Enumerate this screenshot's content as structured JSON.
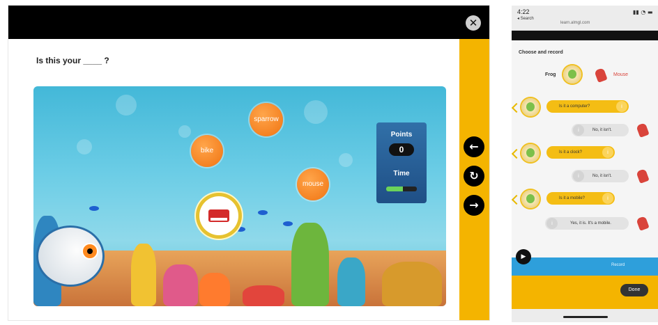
{
  "game": {
    "close_glyph": "✕",
    "question_prefix": "Is this your ____ ?",
    "question_hint": "",
    "words": [
      "sparrow",
      "bike",
      "mouse"
    ],
    "scoreboard": {
      "points_label": "Points",
      "points_value": "0",
      "time_label": "Time",
      "time_fraction": 0.55
    },
    "nav": {
      "prev_glyph": "←",
      "replay_glyph": "↻",
      "next_glyph": "→"
    }
  },
  "phone": {
    "status_time": "4:22",
    "status_back": "◂ Search",
    "url": "learn.almgl.com",
    "status_icons": "▮▮ ◔ ▬",
    "title": "Choose and record",
    "characters": [
      {
        "label": "Frog"
      },
      {
        "label": "Mouse"
      }
    ],
    "chat": [
      {
        "text": "Is it a computer?",
        "speaker": "frog"
      },
      {
        "text": "No, it isn't.",
        "speaker": "mouse"
      },
      {
        "text": "Is it a clock?",
        "speaker": "frog"
      },
      {
        "text": "No, it isn't.",
        "speaker": "mouse"
      },
      {
        "text": "Is it a mobile?",
        "speaker": "frog"
      },
      {
        "text": "Yes, it is. It's a mobile.",
        "speaker": "mouse"
      }
    ],
    "chat_btn_glyph": "i",
    "play_glyph": "▶",
    "record_label": "Record",
    "done_label": "Done"
  },
  "colors": {
    "accent_yellow": "#f4b400",
    "word_orange": "#f07412",
    "record_blue": "#2e9fdb"
  }
}
